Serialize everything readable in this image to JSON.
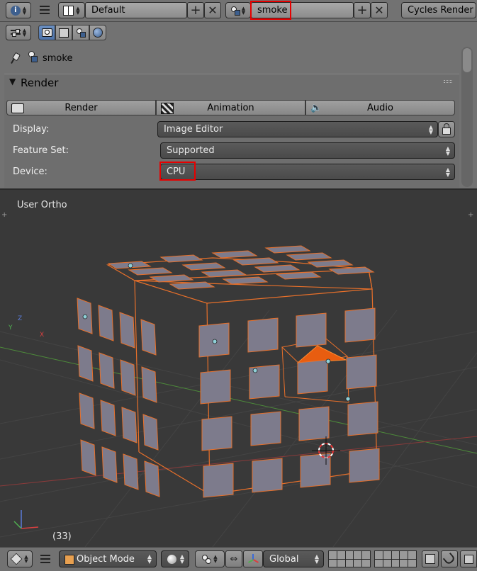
{
  "header": {
    "screen_layout": "Default",
    "scene": "smoke",
    "render_engine": "Cycles Render"
  },
  "properties": {
    "breadcrumb_object": "smoke",
    "panel_title": "Render",
    "buttons": {
      "render": "Render",
      "animation": "Animation",
      "audio": "Audio"
    },
    "rows": {
      "display_label": "Display:",
      "display_value": "Image Editor",
      "feature_label": "Feature Set:",
      "feature_value": "Supported",
      "device_label": "Device:",
      "device_value": "CPU"
    }
  },
  "viewport": {
    "title": "User Ortho",
    "frame": "(33)",
    "axis_labels": {
      "z": "Z",
      "x": "X",
      "y": "Y"
    }
  },
  "footer": {
    "mode": "Object Mode",
    "orientation": "Global"
  },
  "colors": {
    "highlight": "#e60000",
    "selection": "#e8702a",
    "viewport_bg": "#393939"
  }
}
